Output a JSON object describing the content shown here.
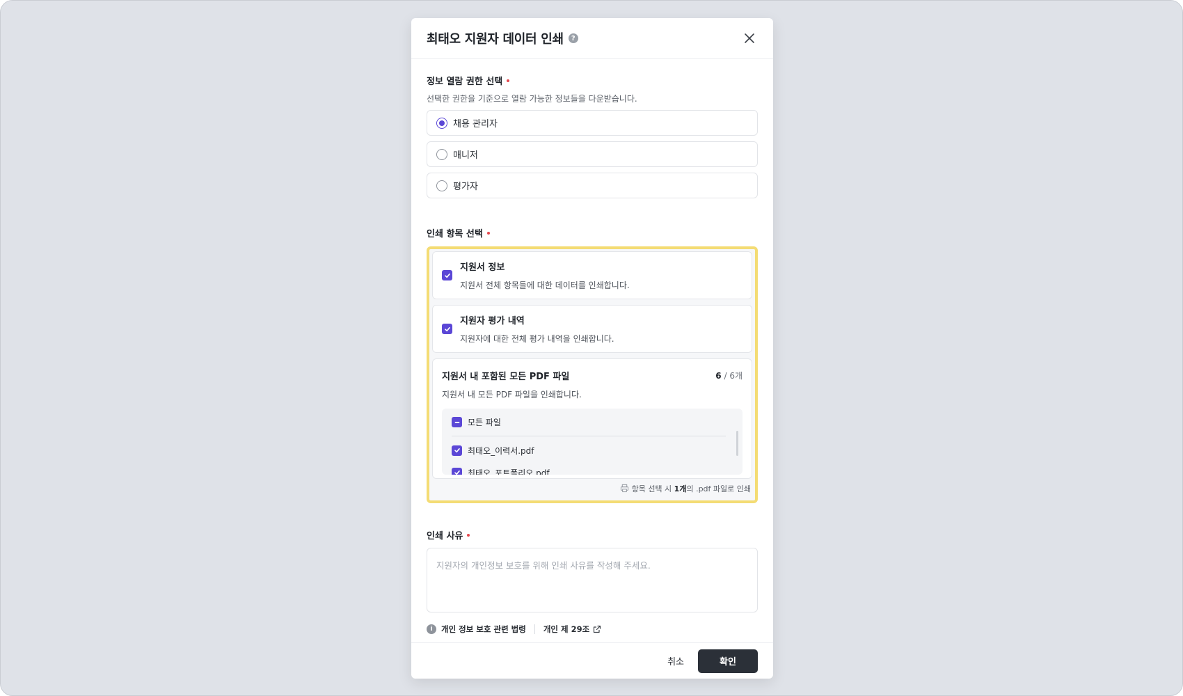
{
  "modal": {
    "title": "최태오 지원자 데이터 인쇄",
    "help_icon": "help-icon",
    "close_icon": "close-icon"
  },
  "permission": {
    "label": "정보 열람 권한 선택",
    "description": "선택한 권한을 기준으로 열람 가능한 정보들을 다운받습니다.",
    "options": [
      {
        "label": "채용 관리자",
        "selected": true
      },
      {
        "label": "매니저",
        "selected": false
      },
      {
        "label": "평가자",
        "selected": false
      }
    ]
  },
  "print_items": {
    "label": "인쇄 항목 선택",
    "items": [
      {
        "title": "지원서 정보",
        "description": "지원서 전체 항목들에 대한 데이터를 인쇄합니다.",
        "checked": true
      },
      {
        "title": "지원자 평가 내역",
        "description": "지원자에 대한 전체 평가 내역을 인쇄합니다.",
        "checked": true
      }
    ],
    "pdf": {
      "title": "지원서 내 포함된 모든 PDF 파일",
      "count_selected": "6",
      "count_sep": "/",
      "count_total": "6개",
      "description": "지원서 내 모든 PDF 파일을 인쇄합니다.",
      "all_files_label": "모든 파일",
      "files": [
        "최태오_이력서.pdf",
        "최태오_포트폴리오.pdf"
      ]
    },
    "note_prefix": "항목 선택 시",
    "note_bold": "1개",
    "note_suffix": "의 .pdf 파일로 인쇄"
  },
  "reason": {
    "label": "인쇄 사유",
    "placeholder": "지원자의 개인정보 보호를 위해 인쇄 사유를 작성해 주세요."
  },
  "law": {
    "label": "개인 정보 보호 관련 법령",
    "link": "개인 제 29조"
  },
  "footer": {
    "cancel": "취소",
    "confirm": "확인"
  },
  "colors": {
    "accent": "#5b47d6",
    "highlight_border": "#f4dc74",
    "required_dot": "#e5484d",
    "confirm_bg": "#2b3038"
  }
}
